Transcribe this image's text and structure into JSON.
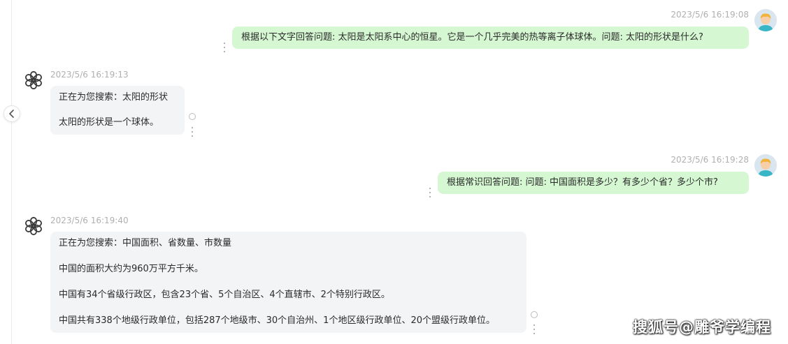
{
  "ui": {
    "collapse_icon": "chevron-left-icon",
    "menu_icon": "vertical-dots-icon",
    "status_icon": "loading-ring-icon"
  },
  "colors": {
    "user_bubble": "#d5f8d2",
    "bot_bubble": "#f3f4f6",
    "timestamp": "#b0b0b0"
  },
  "messages": [
    {
      "role": "user",
      "timestamp": "2023/5/6 16:19:08",
      "text": "根据以下文字回答问题: 太阳是太阳系中心的恒星。它是一个几乎完美的热等离子体球体。问题: 太阳的形状是什么?"
    },
    {
      "role": "assistant",
      "timestamp": "2023/5/6 16:19:13",
      "lines": [
        "正在为您搜索：太阳的形状",
        "太阳的形状是一个球体。"
      ]
    },
    {
      "role": "user",
      "timestamp": "2023/5/6 16:19:28",
      "text": "根据常识回答问题: 问题: 中国面积是多少？有多少个省？多少个市?"
    },
    {
      "role": "assistant",
      "timestamp": "2023/5/6 16:19:40",
      "lines": [
        "正在为您搜索：中国面积、省数量、市数量",
        "中国的面积大约为960万平方千米。",
        "中国有34个省级行政区，包含23个省、5个自治区、4个直辖市、2个特别行政区。",
        "中国共有338个地级行政单位，包括287个地级市、30个自治州、1个地区级行政单位、20个盟级行政单位。"
      ]
    }
  ],
  "watermark": "搜狐号@雕爷学编程"
}
